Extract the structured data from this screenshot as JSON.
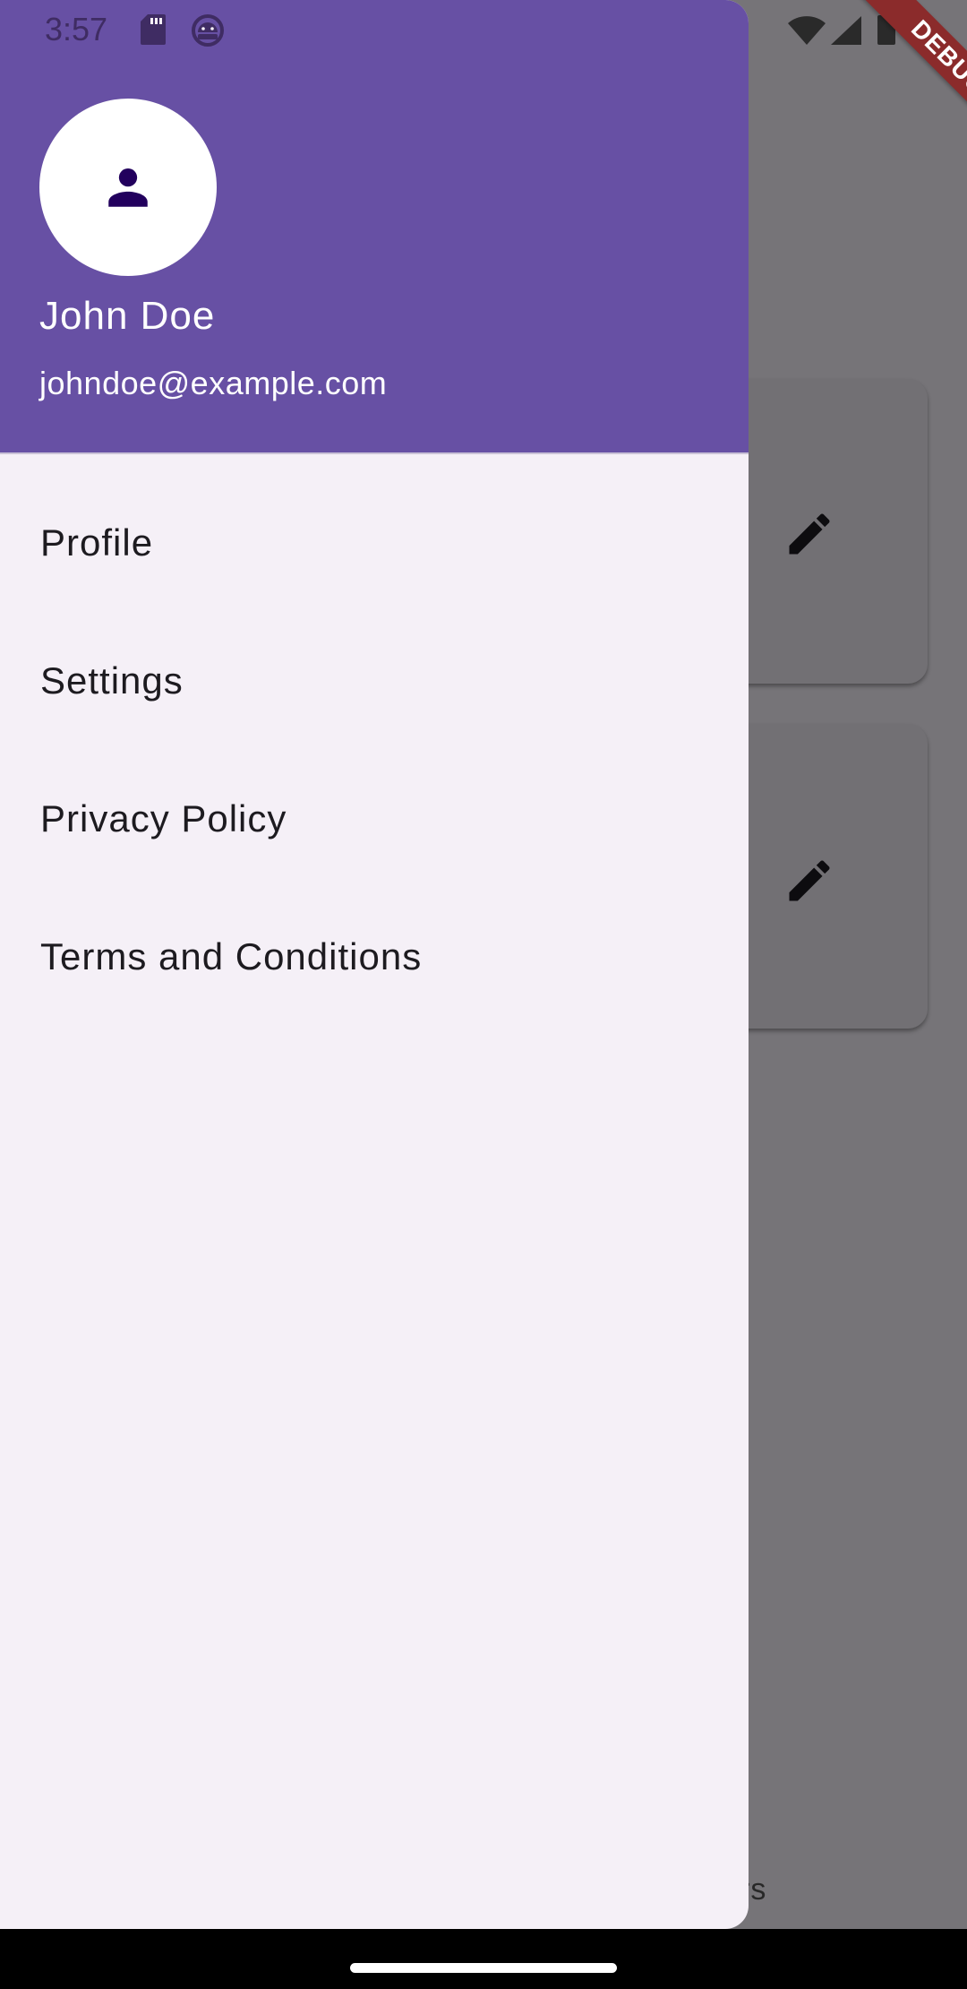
{
  "status_bar": {
    "time": "3:57",
    "icons": [
      "sd-card-icon",
      "android-icon",
      "wifi-icon",
      "signal-icon",
      "battery-icon"
    ]
  },
  "debug_banner": {
    "label": "DEBUG",
    "color": "#8b2b2b"
  },
  "drawer": {
    "header": {
      "background_color": "#6750a4",
      "avatar_icon": "person-icon",
      "name": "John Doe",
      "email": "johndoe@example.com"
    },
    "items": [
      {
        "label": "Profile"
      },
      {
        "label": "Settings"
      },
      {
        "label": "Privacy Policy"
      },
      {
        "label": "Terms and Conditions"
      }
    ]
  },
  "background": {
    "cards": [
      {
        "icon": "edit-icon"
      },
      {
        "icon": "edit-icon"
      }
    ],
    "bottom_label_fragment": "rs"
  }
}
